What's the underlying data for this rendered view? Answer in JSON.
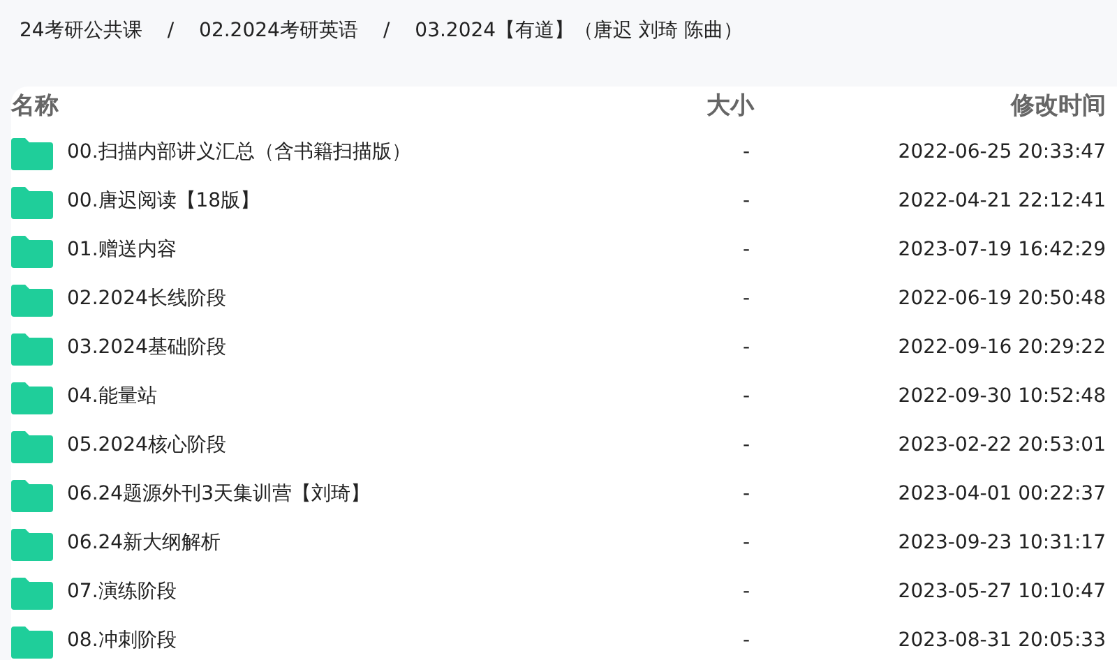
{
  "breadcrumb": [
    {
      "kind": "link",
      "text": "24考研公共课"
    },
    {
      "kind": "separator",
      "text": "/"
    },
    {
      "kind": "link",
      "text": "02.2024考研英语"
    },
    {
      "kind": "separator",
      "text": "/"
    },
    {
      "kind": "link",
      "text": "03.2024【有道】（唐迟 刘琦 陈曲）"
    }
  ],
  "table": {
    "columns": [
      "名称",
      "大小",
      "修改时间"
    ],
    "rows": [
      {
        "name": "00.扫描内部讲义汇总（含书籍扫描版）",
        "size": "-",
        "modified": "2022-06-25 20:33:47"
      },
      {
        "name": "00.唐迟阅读【18版】",
        "size": "-",
        "modified": "2022-04-21 22:12:41"
      },
      {
        "name": "01.赠送内容",
        "size": "-",
        "modified": "2023-07-19 16:42:29"
      },
      {
        "name": "02.2024长线阶段",
        "size": "-",
        "modified": "2022-06-19 20:50:48"
      },
      {
        "name": "03.2024基础阶段",
        "size": "-",
        "modified": "2022-09-16 20:29:22"
      },
      {
        "name": "04.能量站",
        "size": "-",
        "modified": "2022-09-30 10:52:48"
      },
      {
        "name": "05.2024核心阶段",
        "size": "-",
        "modified": "2023-02-22 20:53:01"
      },
      {
        "name": "06.24题源外刊3天集训营【刘琦】",
        "size": "-",
        "modified": "2023-04-01 00:22:37"
      },
      {
        "name": "06.24新大纲解析",
        "size": "-",
        "modified": "2023-09-23 10:31:17"
      },
      {
        "name": "07.演练阶段",
        "size": "-",
        "modified": "2023-05-27 10:10:47"
      },
      {
        "name": "08.冲刺阶段",
        "size": "-",
        "modified": "2023-08-31 20:05:33"
      }
    ]
  }
}
